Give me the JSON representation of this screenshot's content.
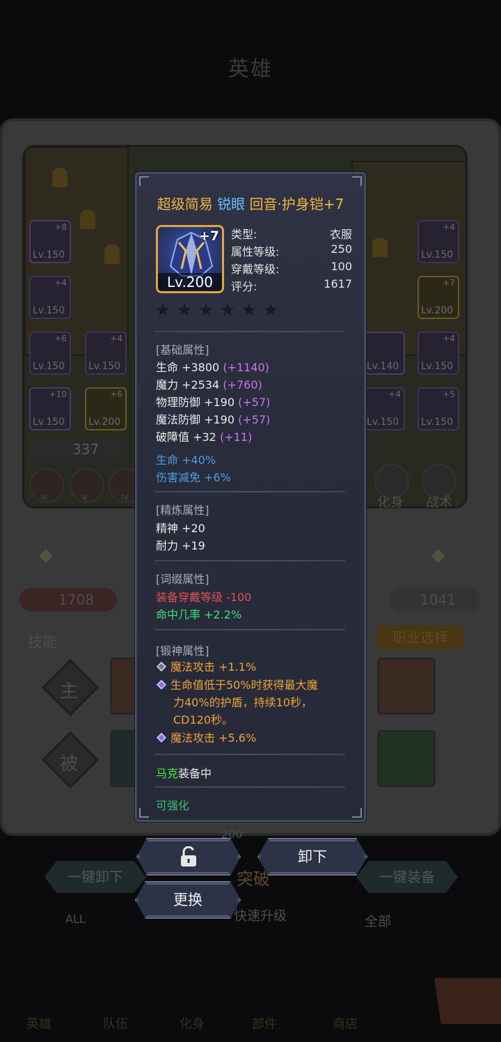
{
  "background": {
    "title": "英雄",
    "power": "337",
    "score_left": "1708",
    "score_right": "1041",
    "skills_label": "技能",
    "skill_active": "主",
    "skill_passive": "被",
    "class_select": "职业选择",
    "transform_label": "化身",
    "tactics_label": "战术",
    "unequip_all": "一键卸下",
    "equip_all": "一键装备",
    "breakthrough": "突破",
    "quick_level": "快速升级",
    "filter_all_short": "ALL",
    "filter_all": "全部",
    "cost": "200",
    "rank_left": [
      "III",
      "V",
      "IV"
    ],
    "left_slots": [
      {
        "lv": "Lv.150",
        "plus": "+8"
      },
      {
        "lv": "Lv.150",
        "plus": "+4"
      },
      {
        "lv": "Lv.150",
        "plus": "+6"
      },
      {
        "lv": "Lv.150",
        "plus": "+4"
      },
      {
        "lv": "Lv.150",
        "plus": "+10"
      },
      {
        "lv": "Lv.200",
        "plus": "+6"
      }
    ],
    "right_slots": [
      {
        "lv": "Lv.150",
        "plus": "+4"
      },
      {
        "lv": "Lv.200",
        "plus": "+7"
      },
      {
        "lv": "Lv.140",
        "plus": ""
      },
      {
        "lv": "Lv.150",
        "plus": "+4"
      },
      {
        "lv": "Lv.150",
        "plus": "+4"
      },
      {
        "lv": "Lv.150",
        "plus": "+5"
      }
    ],
    "bottom_tabs": [
      "英雄",
      "队伍",
      "化身",
      "部件",
      "商店"
    ]
  },
  "item": {
    "name_prefix": "超级简易",
    "name_mid": "锐眼",
    "name_suffix": "回音·护身铠+7",
    "plus": "+7",
    "level": "Lv.200",
    "stats": [
      {
        "label": "类型:",
        "value": "衣服"
      },
      {
        "label": "属性等级:",
        "value": "250"
      },
      {
        "label": "穿戴等级:",
        "value": "100"
      },
      {
        "label": "评分:",
        "value": "1617"
      }
    ],
    "star_count": 6
  },
  "basic": {
    "title": "[基础属性]",
    "lines": [
      {
        "text": "生命 +3800",
        "bonus": "(+1140)"
      },
      {
        "text": "魔力 +2534",
        "bonus": "(+760)"
      },
      {
        "text": "物理防御 +190",
        "bonus": "(+57)"
      },
      {
        "text": "魔法防御 +190",
        "bonus": "(+57)"
      },
      {
        "text": "破障值 +32",
        "bonus": "(+11)"
      }
    ],
    "extra": [
      "生命 +40%",
      "伤害减免 +6%"
    ]
  },
  "refine": {
    "title": "[精炼属性]",
    "lines": [
      "精神 +20",
      "耐力 +19"
    ]
  },
  "affix": {
    "title": "[词缀属性]",
    "negative": "装备穿戴等级 -100",
    "positive": "命中几率 +2.2%"
  },
  "forge": {
    "title": "[锻神属性]",
    "line1": "魔法攻击 +1.1%",
    "line2a": "生命值低于50%时获得最大魔",
    "line2b": "力40%的护盾，持续10秒，",
    "line2c": "CD120秒。",
    "line3": "魔法攻击 +5.6%"
  },
  "equipped": {
    "owner": "马克",
    "status": "装备中"
  },
  "enhance": "可强化",
  "buttons": {
    "unequip": "卸下",
    "replace": "更换"
  },
  "colors": {
    "name_orange": "#f4b63d",
    "name_blue": "#6cc0f0",
    "bonus_purple": "#d26ff2",
    "extra_blue": "#4a9ee6",
    "negative_red": "#e25151",
    "positive_green": "#3ee07b",
    "forge_orange": "#f0a23a"
  }
}
